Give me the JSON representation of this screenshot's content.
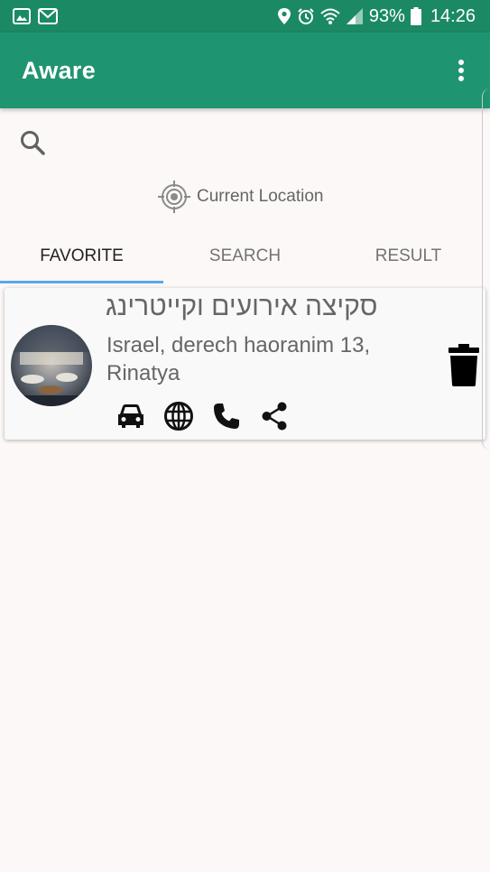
{
  "status_bar": {
    "battery_percent": "93%",
    "time": "14:26",
    "icons": [
      "gallery-icon",
      "mail-icon",
      "location-pin-icon",
      "alarm-icon",
      "wifi-icon",
      "signal-icon",
      "battery-icon"
    ]
  },
  "app_bar": {
    "title": "Aware",
    "menu_icon": "overflow-menu-icon"
  },
  "search": {
    "icon": "search-icon"
  },
  "current_location": {
    "label": "Current Location",
    "icon": "crosshair-icon"
  },
  "tabs": [
    {
      "label": "FAVORITE",
      "active": true
    },
    {
      "label": "SEARCH",
      "active": false
    },
    {
      "label": "RESULT",
      "active": false
    }
  ],
  "favorites": [
    {
      "name": "סקיצה אירועים וקייטרינג",
      "address": "Israel, derech haoranim 13, Rinatya",
      "actions": [
        "car-icon",
        "globe-icon",
        "phone-icon",
        "share-icon"
      ],
      "delete_icon": "trash-icon"
    }
  ],
  "colors": {
    "status_bar": "#1b8a64",
    "app_bar": "#1f9470",
    "tab_indicator": "#5aa9e4",
    "background": "#fcf8f7"
  }
}
